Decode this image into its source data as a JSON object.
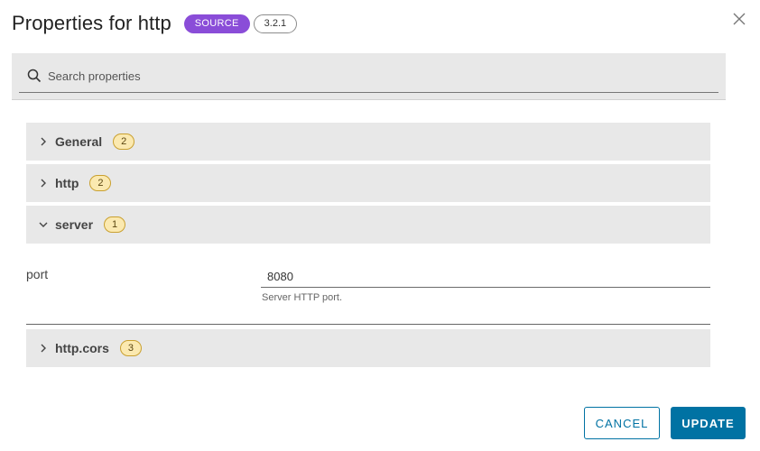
{
  "header": {
    "title_prefix": "Properties for",
    "title_name": "http",
    "type_badge": "SOURCE",
    "version_badge": "3.2.1"
  },
  "search": {
    "placeholder": "Search properties",
    "value": ""
  },
  "groups": [
    {
      "label": "General",
      "count": "2",
      "expanded": false
    },
    {
      "label": "http",
      "count": "2",
      "expanded": false
    },
    {
      "label": "server",
      "count": "1",
      "expanded": true
    },
    {
      "label": "http.cors",
      "count": "3",
      "expanded": false
    }
  ],
  "server_properties": [
    {
      "label": "port",
      "value": "8080",
      "help": "Server HTTP port."
    }
  ],
  "footer": {
    "cancel_label": "CANCEL",
    "update_label": "UPDATE"
  },
  "colors": {
    "type_badge": "#8a4dd8",
    "count_badge_bg": "#fbe9b0",
    "primary": "#0072a3",
    "group_bg": "#e8e8e8"
  },
  "icons": {
    "close": "close-icon",
    "search": "search-icon",
    "collapsed": "chevron-right-icon",
    "expanded": "chevron-down-icon"
  }
}
